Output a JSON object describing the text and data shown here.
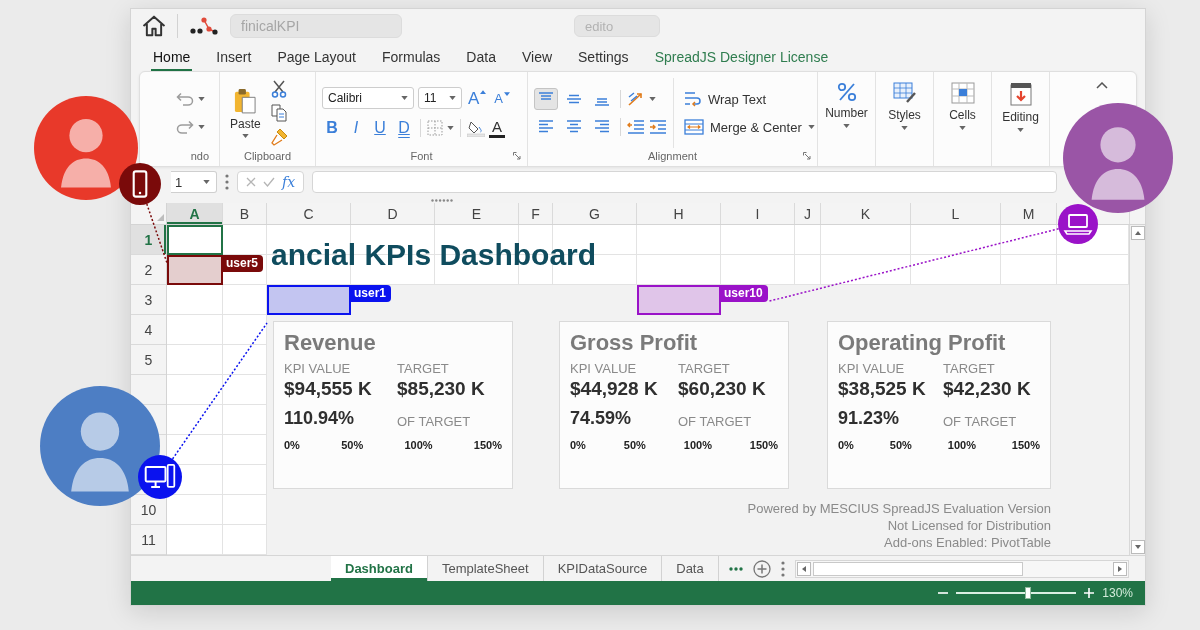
{
  "app_bar": {
    "file_name_field": {
      "value": "finicalKPI"
    },
    "second_field": {
      "value": "edito"
    }
  },
  "ribbon": {
    "tabs": [
      {
        "label": "Home",
        "kind": "tab",
        "selected": true
      },
      {
        "label": "Insert",
        "kind": "tab",
        "selected": false
      },
      {
        "label": "Page Layout",
        "kind": "tab",
        "selected": false
      },
      {
        "label": "Formulas",
        "kind": "tab",
        "selected": false
      },
      {
        "label": "Data",
        "kind": "tab",
        "selected": false
      },
      {
        "label": "View",
        "kind": "tab",
        "selected": false
      },
      {
        "label": "Settings",
        "kind": "tab",
        "selected": false
      },
      {
        "label": "SpreadJS Designer License",
        "kind": "license",
        "selected": false
      }
    ],
    "undo_group": {
      "label": "ndo"
    },
    "clipboard_group": {
      "label": "Clipboard",
      "paste_button": "Paste"
    },
    "font_group": {
      "label": "Font",
      "font_name": "Calibri",
      "font_size": "11",
      "grow_font_button": "A",
      "shrink_font_button": "A",
      "style_buttons": [
        {
          "kind": "bold",
          "label": "B"
        },
        {
          "kind": "italic",
          "label": "I"
        },
        {
          "kind": "underline",
          "label": "U"
        },
        {
          "kind": "double_underline",
          "label": "D"
        }
      ],
      "font_color_button": "A"
    },
    "alignment_group": {
      "label": "Alignment",
      "align_buttons": [
        {
          "kind": "top",
          "selected": true
        },
        {
          "kind": "middle",
          "selected": false
        },
        {
          "kind": "bottom",
          "selected": false
        },
        {
          "kind": "left",
          "selected": false
        },
        {
          "kind": "center",
          "selected": false
        },
        {
          "kind": "right",
          "selected": false
        }
      ],
      "wrap_text_button": "Wrap Text",
      "merge_button": "Merge & Center"
    },
    "menu_buttons": [
      {
        "kind": "number",
        "label": "Number"
      },
      {
        "kind": "styles",
        "label": "Styles"
      },
      {
        "kind": "cells",
        "label": "Cells"
      },
      {
        "kind": "editing",
        "label": "Editing"
      }
    ]
  },
  "formula_bar": {
    "name_box": "1",
    "function_button": "fx"
  },
  "sheet": {
    "columns": [
      {
        "label": "A",
        "selected": true
      },
      {
        "label": "B",
        "selected": false
      },
      {
        "label": "C",
        "selected": false
      },
      {
        "label": "D",
        "selected": false
      },
      {
        "label": "E",
        "selected": false
      },
      {
        "label": "F",
        "selected": false
      },
      {
        "label": "G",
        "selected": false
      },
      {
        "label": "H",
        "selected": false
      },
      {
        "label": "I",
        "selected": false
      },
      {
        "label": "J",
        "selected": false
      },
      {
        "label": "K",
        "selected": false
      },
      {
        "label": "L",
        "selected": false
      },
      {
        "label": "M",
        "selected": false
      }
    ],
    "rows": [
      {
        "label": "1",
        "selected": true
      },
      {
        "label": "2",
        "selected": false
      },
      {
        "label": "3",
        "selected": false
      },
      {
        "label": "4",
        "selected": false
      },
      {
        "label": "5",
        "selected": false
      },
      {
        "label": "10",
        "selected": false
      },
      {
        "label": "11",
        "selected": false
      }
    ],
    "title": "ancial KPIs Dashboard",
    "cards": [
      {
        "title": "Revenue",
        "kpi_label": "KPI VALUE",
        "target_label": "TARGET",
        "kpi_value": "$94,555 K",
        "target_value": "$85,230 K",
        "percent": "110.94%",
        "percent_label": "OF TARGET",
        "scale": [
          "0%",
          "50%",
          "100%",
          "150%"
        ]
      },
      {
        "title": "Gross Profit",
        "kpi_label": "KPI VALUE",
        "target_label": "TARGET",
        "kpi_value": "$44,928 K",
        "target_value": "$60,230 K",
        "percent": "74.59%",
        "percent_label": "OF TARGET",
        "scale": [
          "0%",
          "50%",
          "100%",
          "150%"
        ]
      },
      {
        "title": "Operating Profit",
        "kpi_label": "KPI VALUE",
        "target_label": "TARGET",
        "kpi_value": "$38,525 K",
        "target_value": "$42,230 K",
        "percent": "91.23%",
        "percent_label": "OF TARGET",
        "scale": [
          "0%",
          "50%",
          "100%",
          "150%"
        ]
      }
    ],
    "evaluation_notice": [
      "Powered by MESCIUS SpreadJS Evaluation Version",
      "Not Licensed for Distribution",
      "Add-ons Enabled: PivotTable"
    ]
  },
  "collaborators": [
    {
      "name": "user5",
      "color": "#7a0a0a",
      "kind": "phone",
      "avatar": {
        "color": "#e8392a"
      }
    },
    {
      "name": "user1",
      "color": "#0a12ef",
      "kind": "desktop",
      "avatar": {
        "color": "#4d7ec4"
      }
    },
    {
      "name": "user10",
      "color": "#9a12c8",
      "kind": "laptop",
      "avatar": {
        "color": "#9a55a6"
      }
    }
  ],
  "sheet_tabs": [
    {
      "label": "Dashboard",
      "selected": true
    },
    {
      "label": "TemplateSheet",
      "selected": false
    },
    {
      "label": "KPIDataSource",
      "selected": false
    },
    {
      "label": "Data",
      "selected": false
    }
  ],
  "status_bar": {
    "zoom": {
      "level": 0.6
    },
    "zoom_text": "130%"
  }
}
